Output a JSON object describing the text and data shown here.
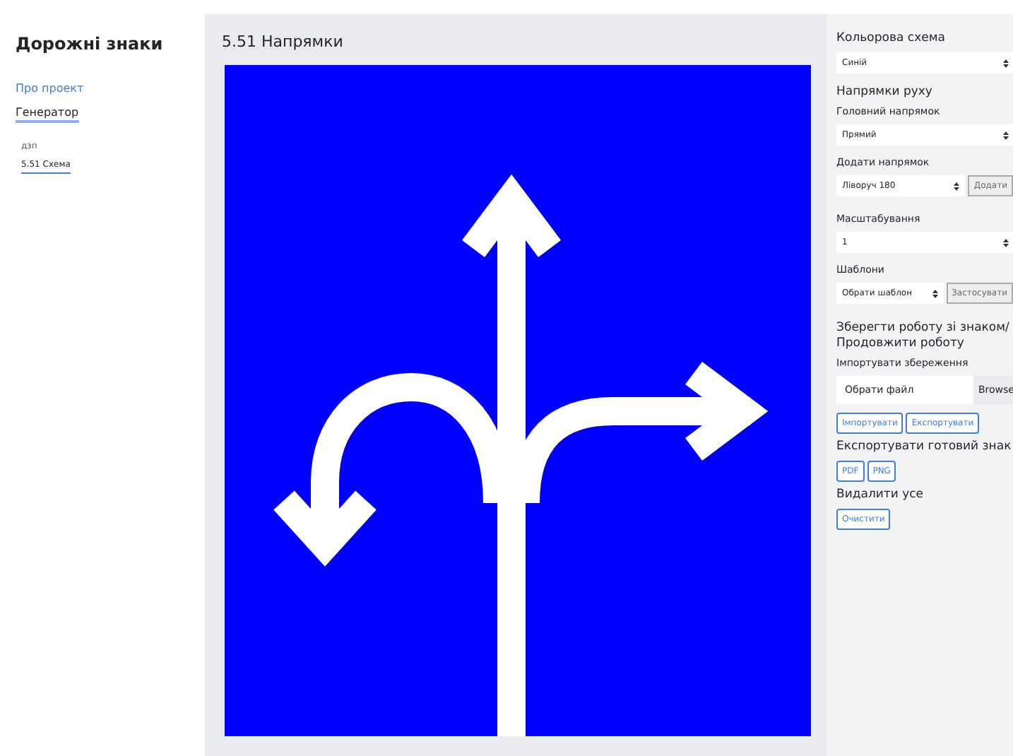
{
  "sidebar": {
    "title": "Дорожні знаки",
    "nav": [
      {
        "label": "Про проект",
        "selected": false
      },
      {
        "label": "Генератор",
        "selected": true
      }
    ],
    "subnav_heading": "дзп",
    "subnav": [
      {
        "label": "5.51 Схема",
        "selected": true
      }
    ]
  },
  "main": {
    "title": "5.51 Напрямки"
  },
  "panel": {
    "sections": [
      {
        "kind": "select",
        "heading": "Кольорова схема",
        "value": "Синій"
      },
      {
        "kind": "heading",
        "heading": "Напрямки руху"
      },
      {
        "kind": "select",
        "label": "Головний напрямок",
        "value": "Прямий"
      },
      {
        "kind": "select-button",
        "label": "Додати напрямок",
        "value": "Ліворуч 180",
        "button": "Додати"
      },
      {
        "kind": "select",
        "label": "Масштабування",
        "value": "1"
      },
      {
        "kind": "select-button",
        "label": "Шаблони",
        "value": "Обрати шаблон",
        "button": "Застосувати"
      },
      {
        "kind": "heading",
        "heading": "Зберегти роботу зі знаком/ Продовжити роботу"
      },
      {
        "kind": "file",
        "label": "Імпортувати збереження",
        "placeholder": "Обрати файл",
        "button": "Browse"
      },
      {
        "kind": "buttons",
        "buttons": [
          "Імпортувати",
          "Експортувати"
        ]
      },
      {
        "kind": "buttons",
        "heading": "Експортувати готовий знак",
        "buttons": [
          "PDF",
          "PNG"
        ]
      },
      {
        "kind": "buttons",
        "heading": "Видалити усе",
        "buttons": [
          "Очистити"
        ]
      }
    ]
  }
}
